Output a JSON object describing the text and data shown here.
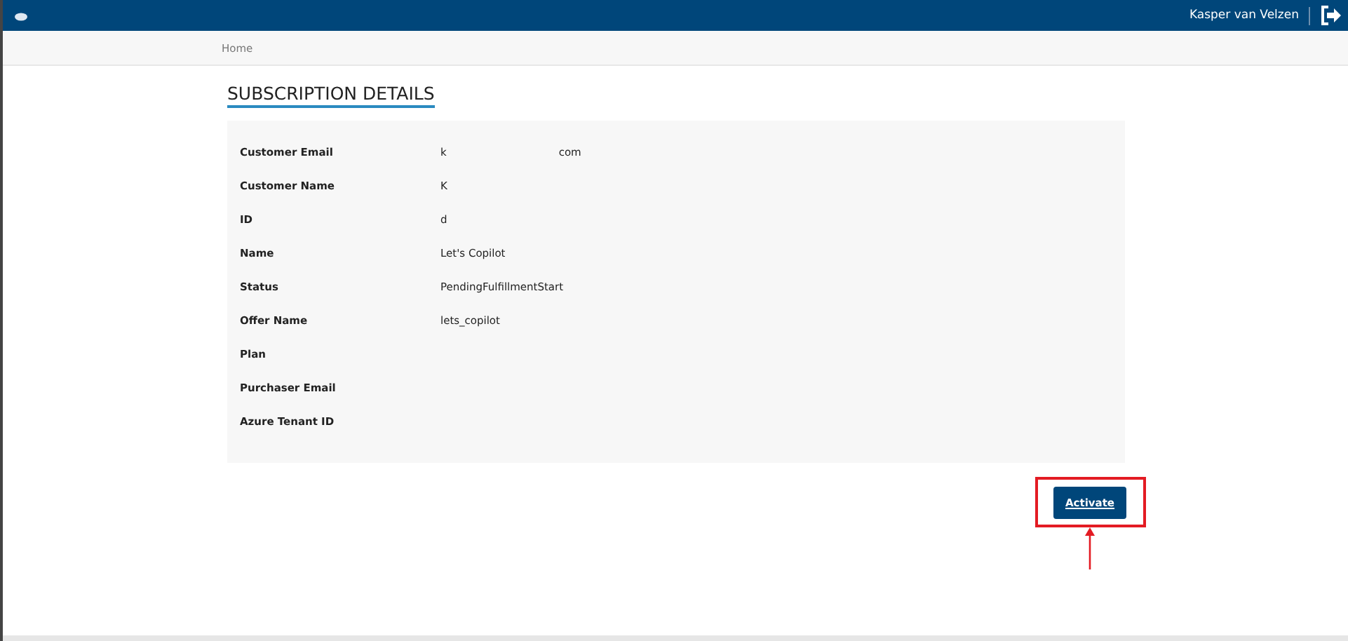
{
  "header": {
    "user_name": "Kasper van Velzen"
  },
  "breadcrumb": [
    "Home"
  ],
  "title": "SUBSCRIPTION DETAILS",
  "details": [
    {
      "label": "Customer Email",
      "value_parts": [
        "k",
        "com"
      ]
    },
    {
      "label": "Customer Name",
      "value_parts": [
        "K"
      ]
    },
    {
      "label": "ID",
      "value_parts": [
        "d"
      ]
    },
    {
      "label": "Name",
      "value_parts": [
        "Let's Copilot"
      ]
    },
    {
      "label": "Status",
      "value_parts": [
        "PendingFulfillmentStart"
      ]
    },
    {
      "label": "Offer Name",
      "value_parts": [
        "lets_copilot"
      ]
    },
    {
      "label": "Plan"
    },
    {
      "label": "Purchaser Email"
    },
    {
      "label": "Azure Tenant ID"
    }
  ],
  "activate_button": {
    "label": "Activate",
    "highlighted": true
  }
}
